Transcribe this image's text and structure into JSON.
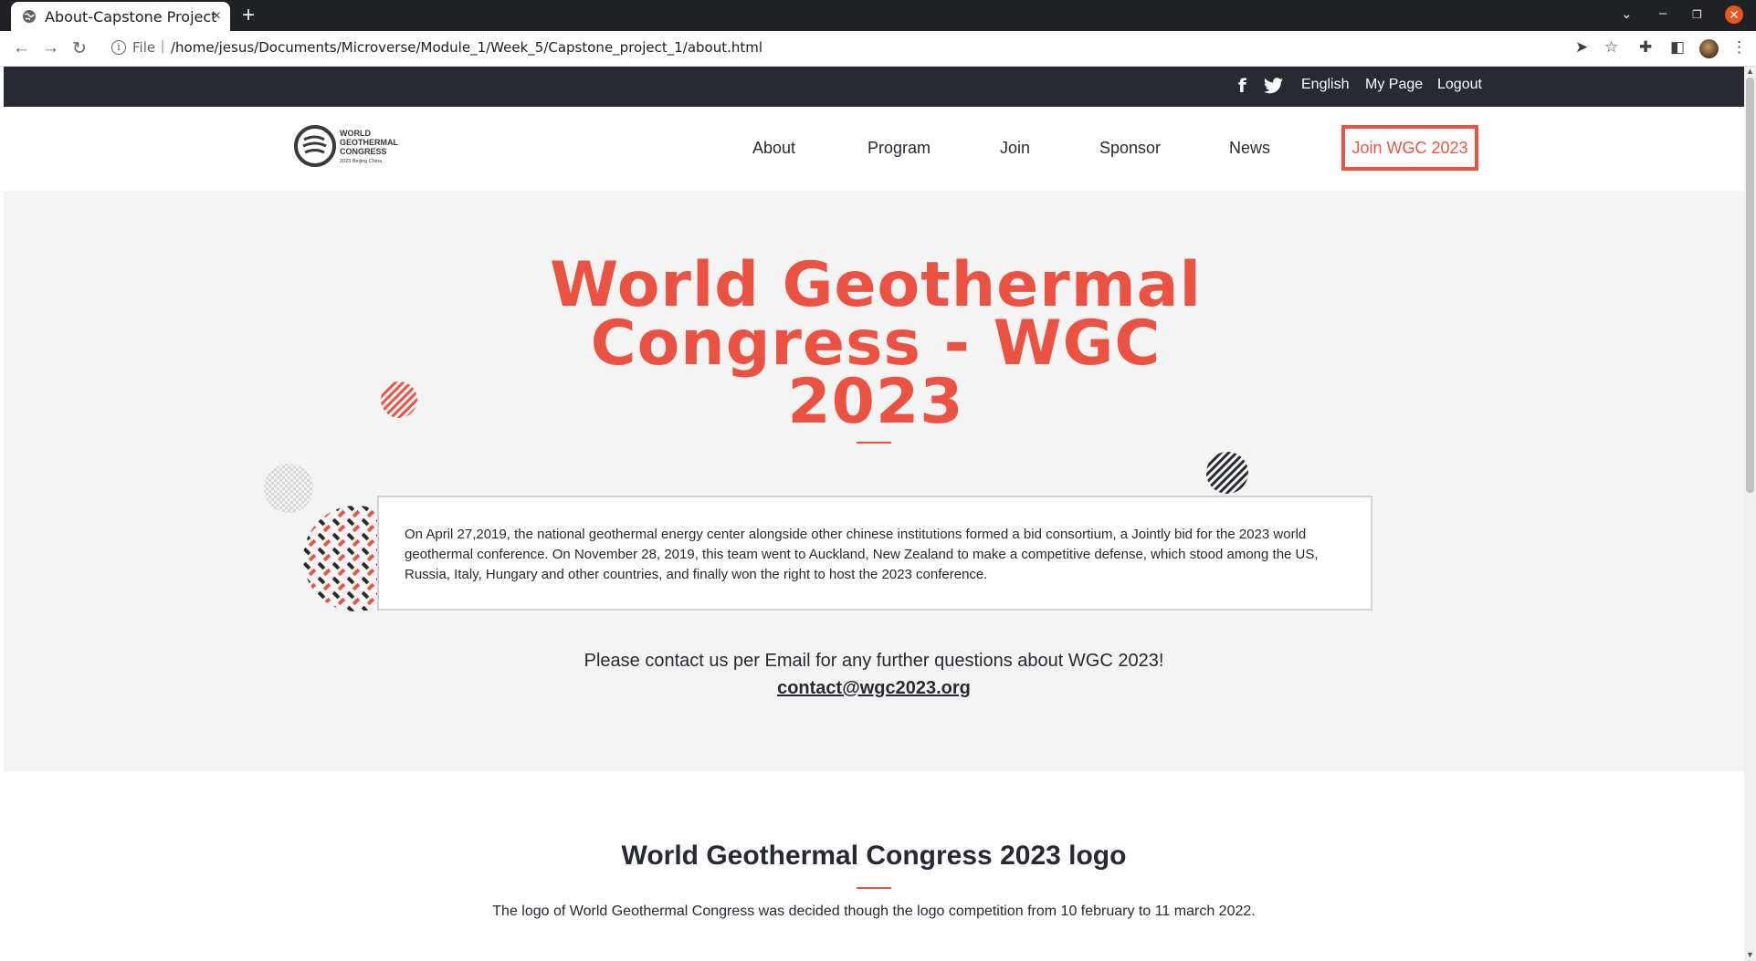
{
  "browser": {
    "tab_title": "About-Capstone Project",
    "tab_close": "×",
    "new_tab": "+",
    "url_scheme": "File",
    "url_path": "/home/jesus/Documents/Microverse/Module_1/Week_5/Capstone_project_1/about.html",
    "icons": [
      "globe-icon",
      "back-icon",
      "forward-icon",
      "reload-icon",
      "info-icon",
      "share-icon",
      "star-icon",
      "extensions-icon",
      "sidepanel-icon",
      "menu-icon",
      "minimize-icon",
      "restore-icon",
      "close-icon",
      "chevron-down-icon"
    ]
  },
  "topbar": {
    "facebook": "f",
    "language": "English",
    "my_page": "My Page",
    "logout": "Logout"
  },
  "logo": {
    "line1": "WORLD",
    "line2": "GEOTHERMAL",
    "line3": "CONGRESS",
    "line4": "2023 Beijing China"
  },
  "nav": {
    "about": "About",
    "program": "Program",
    "join": "Join",
    "sponsor": "Sponsor",
    "news": "News",
    "cta": "Join WGC 2023"
  },
  "hero": {
    "title_line1": "World Geothermal",
    "title_line2": "Congress - WGC",
    "title_line3": "2023",
    "description": "On April 27,2019, the national geothermal energy center alongside other chinese institutions formed a bid consortium, a Jointly bid for the 2023 world geothermal conference. On November 28, 2019, this team went to Auckland, New Zealand to make a competitive defense, which stood among the US, Russia, Italy, Hungary and other countries, and finally won the right to host the 2023 conference.",
    "contact_text": "Please contact us per Email for any further questions about WGC 2023!",
    "contact_email": "contact@wgc2023.org"
  },
  "logo_section": {
    "title": "World Geothermal Congress 2023 logo",
    "description": "The logo of World Geothermal Congress was decided though the logo competition from 10 february to 11 march 2022."
  },
  "colors": {
    "accent": "#ec5242",
    "dark": "#272a31",
    "hero_bg": "#f4f4f4"
  }
}
